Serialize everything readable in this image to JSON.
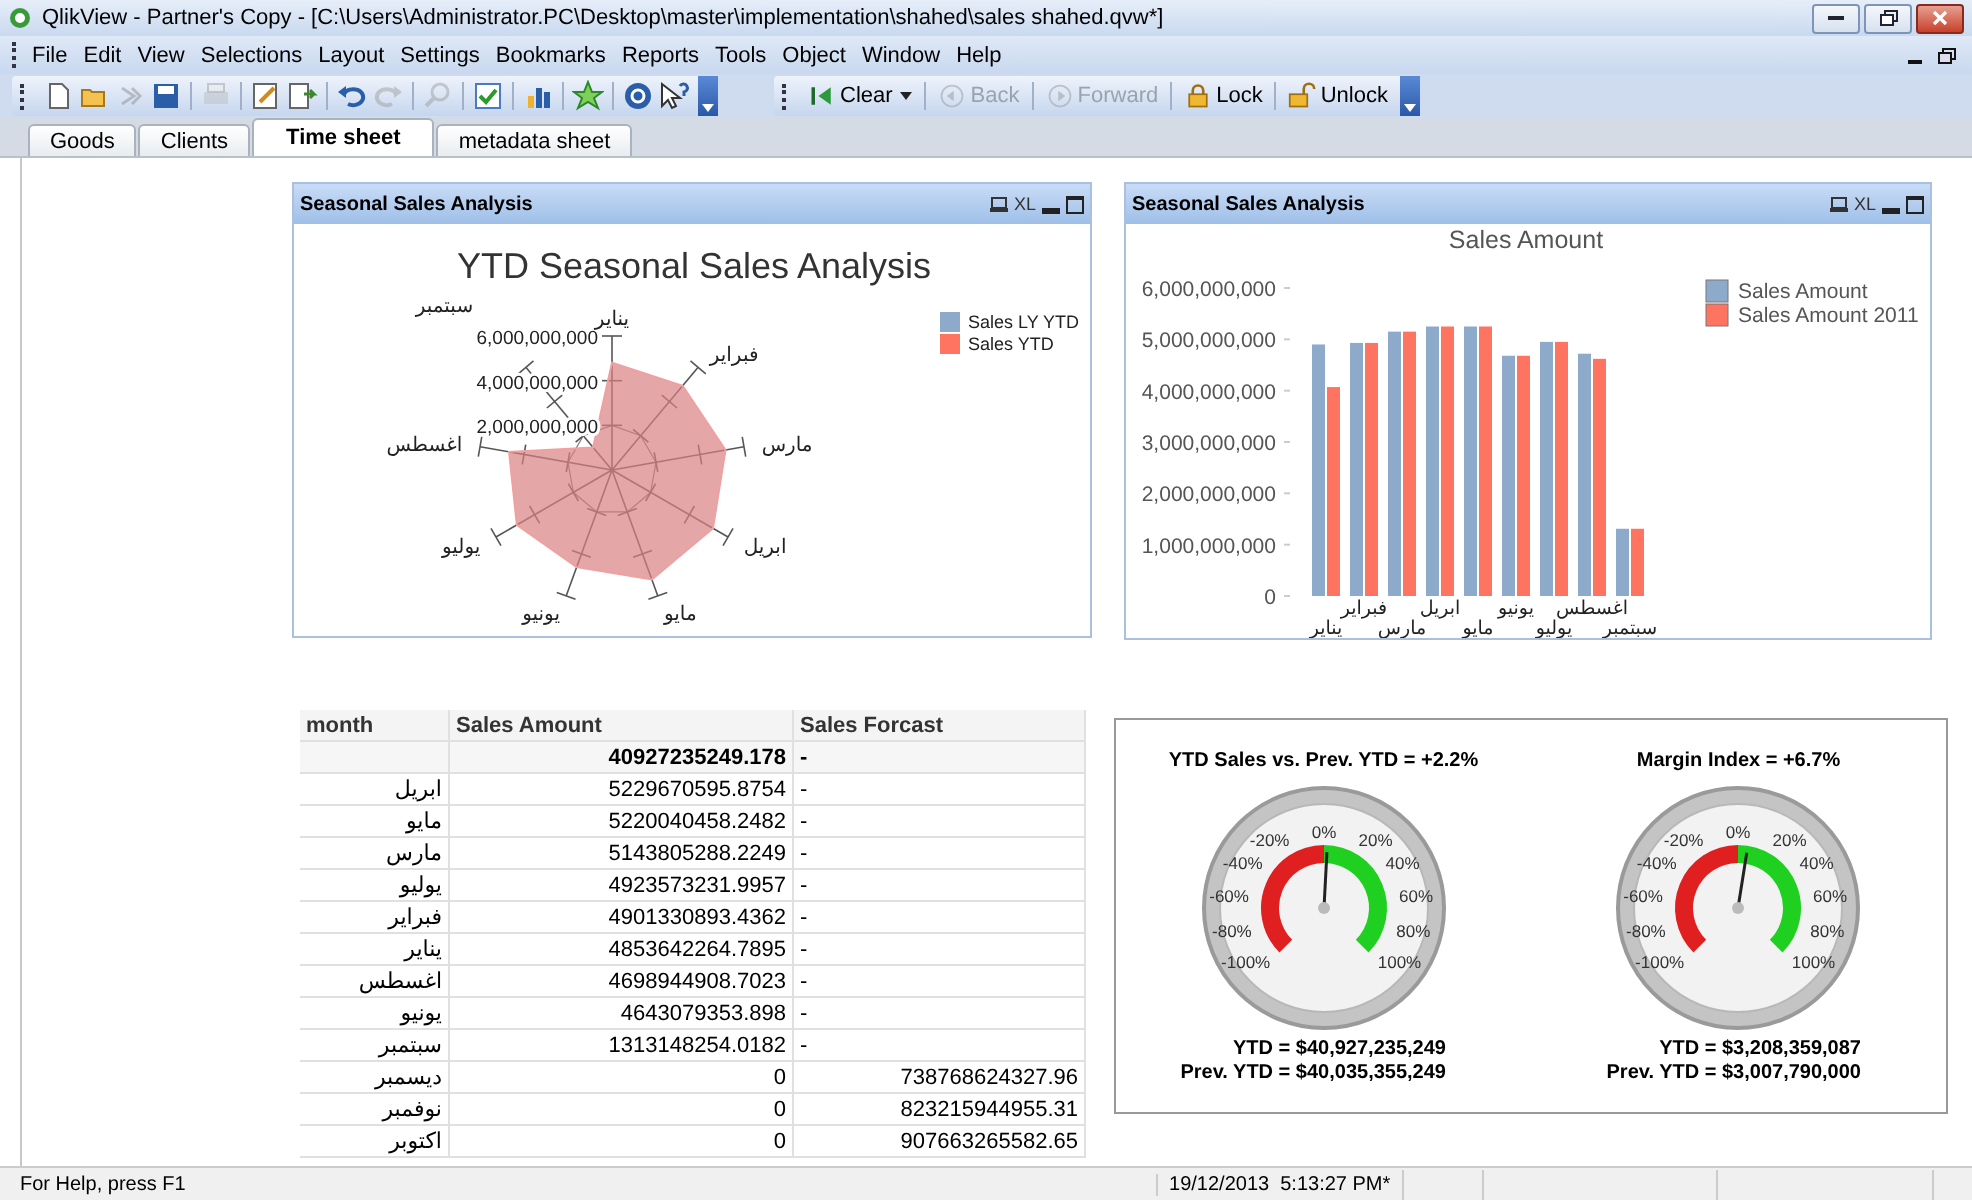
{
  "window": {
    "title": "QlikView - Partner's Copy - [C:\\Users\\Administrator.PC\\Desktop\\master\\implementation\\shahed\\sales shahed.qvw*]"
  },
  "menu": [
    "File",
    "Edit",
    "View",
    "Selections",
    "Layout",
    "Settings",
    "Bookmarks",
    "Reports",
    "Tools",
    "Object",
    "Window",
    "Help"
  ],
  "toolbar": {
    "groups": [
      [
        {
          "kind": "new",
          "disabled": false
        },
        {
          "kind": "open",
          "disabled": false
        },
        {
          "kind": "reload",
          "disabled": true
        },
        {
          "kind": "save",
          "disabled": false
        }
      ],
      [
        {
          "kind": "print",
          "disabled": true
        }
      ],
      [
        {
          "kind": "edit_script",
          "disabled": false
        },
        {
          "kind": "reload_data",
          "disabled": false
        }
      ],
      [
        {
          "kind": "undo",
          "disabled": false
        },
        {
          "kind": "redo",
          "disabled": true
        }
      ],
      [
        {
          "kind": "search",
          "disabled": true
        }
      ],
      [
        {
          "kind": "check",
          "disabled": false
        }
      ],
      [
        {
          "kind": "chart",
          "disabled": false
        }
      ],
      [
        {
          "kind": "star",
          "disabled": false
        }
      ],
      [
        {
          "kind": "help",
          "disabled": false
        },
        {
          "kind": "context_help",
          "disabled": false
        }
      ]
    ]
  },
  "selection_toolbar": [
    {
      "kind": "clear",
      "label": "Clear",
      "disabled": false
    },
    {
      "kind": "back",
      "label": "Back",
      "disabled": true
    },
    {
      "kind": "forward",
      "label": "Forward",
      "disabled": true
    },
    {
      "kind": "lock",
      "label": "Lock",
      "disabled": false
    },
    {
      "kind": "unlock",
      "label": "Unlock",
      "disabled": false
    }
  ],
  "tabs": [
    {
      "label": "Goods",
      "selected": false
    },
    {
      "label": "Clients",
      "selected": false
    },
    {
      "label": "Time sheet",
      "selected": true
    },
    {
      "label": "metadata sheet",
      "selected": false
    }
  ],
  "radar": {
    "caption": "Seasonal Sales Analysis",
    "caption_xl": "XL",
    "title": "YTD Seasonal Sales Analysis",
    "axis_labels": [
      "يناير",
      "سبتمبر",
      "فبراير",
      "اغسطس",
      "مارس",
      "يوليو",
      "ابريل",
      "يونيو",
      "مايو"
    ],
    "tick_labels": [
      "6,000,000,000",
      "4,000,000,000",
      "2,000,000,000"
    ],
    "legend": [
      {
        "name": "Sales LY YTD",
        "color": "#8eaacb"
      },
      {
        "name": "Sales YTD",
        "color": "#ff7461"
      }
    ]
  },
  "bar": {
    "caption": "Seasonal Sales Analysis",
    "caption_xl": "XL",
    "chart_data": {
      "type": "bar",
      "title": "Sales Amount",
      "categories": [
        "يناير",
        "فبراير",
        "مارس",
        "ابريل",
        "مايو",
        "يونيو",
        "يوليو",
        "اغسطس",
        "سبتمبر"
      ],
      "series": [
        {
          "name": "Sales Amount",
          "color": "#8eaacb",
          "values": [
            4900000000,
            4930000000,
            5150000000,
            5250000000,
            5250000000,
            4680000000,
            4950000000,
            4720000000,
            1310000000
          ]
        },
        {
          "name": "Sales Amount 2011",
          "color": "#ff7461",
          "values": [
            4070000000,
            4930000000,
            5150000000,
            5250000000,
            5250000000,
            4680000000,
            4950000000,
            4620000000,
            1310000000
          ]
        }
      ],
      "ylim": [
        0,
        6000000000
      ],
      "legend": true,
      "yticks": [
        {
          "value": 0,
          "label": "0"
        },
        {
          "value": 1000000000,
          "label": "1,000,000,000"
        },
        {
          "value": 2000000000,
          "label": "2,000,000,000"
        },
        {
          "value": 3000000000,
          "label": "3,000,000,000"
        },
        {
          "value": 4000000000,
          "label": "4,000,000,000"
        },
        {
          "value": 5000000000,
          "label": "5,000,000,000"
        },
        {
          "value": 6000000000,
          "label": "6,000,000,000"
        }
      ]
    }
  },
  "table": {
    "columns": [
      "month",
      "Sales Amount",
      "Sales Forcast"
    ],
    "total": {
      "sales_amount": "40927235249.178",
      "sales_forcast": "-"
    },
    "rows": [
      {
        "month": "ابريل",
        "sales_amount": "5229670595.8754",
        "sales_forcast": "-"
      },
      {
        "month": "مايو",
        "sales_amount": "5220040458.2482",
        "sales_forcast": "-"
      },
      {
        "month": "مارس",
        "sales_amount": "5143805288.2249",
        "sales_forcast": "-"
      },
      {
        "month": "يوليو",
        "sales_amount": "4923573231.9957",
        "sales_forcast": "-"
      },
      {
        "month": "فبراير",
        "sales_amount": "4901330893.4362",
        "sales_forcast": "-"
      },
      {
        "month": "يناير",
        "sales_amount": "4853642264.7895",
        "sales_forcast": "-"
      },
      {
        "month": "اغسطس",
        "sales_amount": "4698944908.7023",
        "sales_forcast": "-"
      },
      {
        "month": "يونيو",
        "sales_amount": "4643079353.898",
        "sales_forcast": "-"
      },
      {
        "month": "سبتمبر",
        "sales_amount": "1313148254.0182",
        "sales_forcast": "-"
      },
      {
        "month": "ديسمبر",
        "sales_amount": "0",
        "sales_forcast": "738768624327.96"
      },
      {
        "month": "نوفمبر",
        "sales_amount": "0",
        "sales_forcast": "823215944955.31"
      },
      {
        "month": "اكتوبر",
        "sales_amount": "0",
        "sales_forcast": "907663265582.65"
      }
    ]
  },
  "gauges": [
    {
      "title": "YTD Sales vs. Prev. YTD = +2.2%",
      "tick_labels": [
        "-100%",
        "-80%",
        "-60%",
        "-40%",
        "-20%",
        "0%",
        "20%",
        "40%",
        "60%",
        "80%",
        "100%"
      ],
      "ytd": "YTD = $40,927,235,249",
      "prev_ytd": "Prev. YTD = $40,035,355,249"
    },
    {
      "title": "Margin Index = +6.7%",
      "tick_labels": [
        "-100%",
        "-80%",
        "-60%",
        "-40%",
        "-20%",
        "0%",
        "20%",
        "40%",
        "60%",
        "80%",
        "100%"
      ],
      "ytd": "YTD = $3,208,359,087",
      "prev_ytd": "Prev. YTD = $3,007,790,000"
    }
  ],
  "status_bar": {
    "help": "For Help, press F1",
    "datetime": "19/12/2013  5:13:27 PM*"
  }
}
